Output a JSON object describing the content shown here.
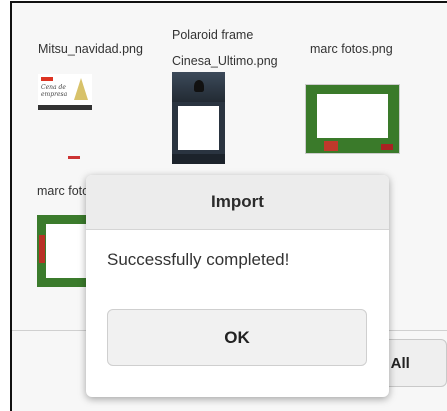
{
  "files": [
    {
      "name": "Mitsu_navidad.png",
      "thumb_text": "Cena de\nempresa"
    },
    {
      "label_top": "Polaroid frame",
      "name": "Cinesa_Ultimo.png"
    },
    {
      "name": "marc fotos.png"
    },
    {
      "name": "marc fotos"
    }
  ],
  "import_all_button": "ort All",
  "dialog": {
    "title": "Import",
    "message": "Successfully completed!",
    "ok_label": "OK"
  }
}
